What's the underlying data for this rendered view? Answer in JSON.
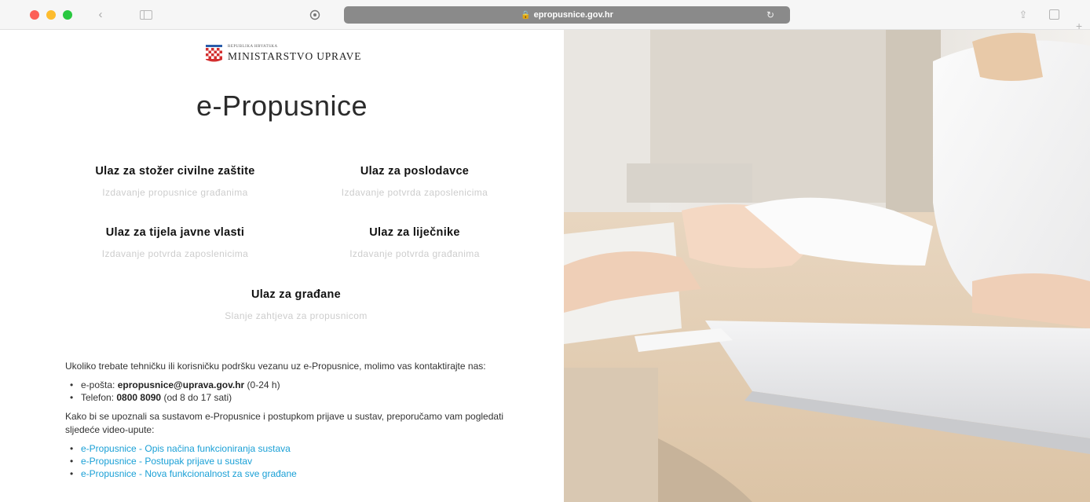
{
  "browser": {
    "url": "epropusnice.gov.hr",
    "lock_glyph": "🔒",
    "reload_glyph": "↻",
    "back_glyph": "‹",
    "share_glyph": "⇪",
    "new_tab_glyph": "+",
    "traffic_colors": {
      "close": "#fc5f57",
      "minimize": "#fdbc2e",
      "maximize": "#29c840"
    }
  },
  "logo": {
    "small_text": "REPUBLIKA HRVATSKA",
    "ministry": "MINISTARSTVO UPRAVE"
  },
  "site_title": "e-Propusnice",
  "entries": [
    {
      "title": "Ulaz za stožer civilne zaštite",
      "subtitle": "Izdavanje propusnice građanima"
    },
    {
      "title": "Ulaz za poslodavce",
      "subtitle": "Izdavanje potvrda zaposlenicima"
    },
    {
      "title": "Ulaz za tijela javne vlasti",
      "subtitle": "Izdavanje potvrda zaposlenicima"
    },
    {
      "title": "Ulaz za liječnike",
      "subtitle": "Izdavanje potvrda građanima"
    },
    {
      "title": "Ulaz za građane",
      "subtitle": "Slanje zahtjeva za propusnicom"
    }
  ],
  "support": {
    "intro": "Ukoliko trebate tehničku ili korisničku podršku vezanu uz e-Propusnice, molimo vas kontaktirajte nas:",
    "email_label": "e-pošta: ",
    "email": "epropusnice@uprava.gov.hr",
    "email_hours": " (0-24 h)",
    "phone_label": "Telefon: ",
    "phone": "0800 8090",
    "phone_hours": " (od 8 do 17 sati)",
    "video_intro": "Kako bi se upoznali sa sustavom e-Propusnice i postupkom prijave u sustav, preporučamo vam pogledati sljedeće video-upute:",
    "videos": [
      "e-Propusnice - Opis načina funkcioniranja sustava",
      "e-Propusnice - Postupak prijave u sustav",
      "e-Propusnice - Nova funkcionalnost za sve građane"
    ]
  },
  "colors": {
    "link": "#1aa0d6",
    "subtitle": "#cdcdcd",
    "urlbar": "#8a8a8a"
  }
}
